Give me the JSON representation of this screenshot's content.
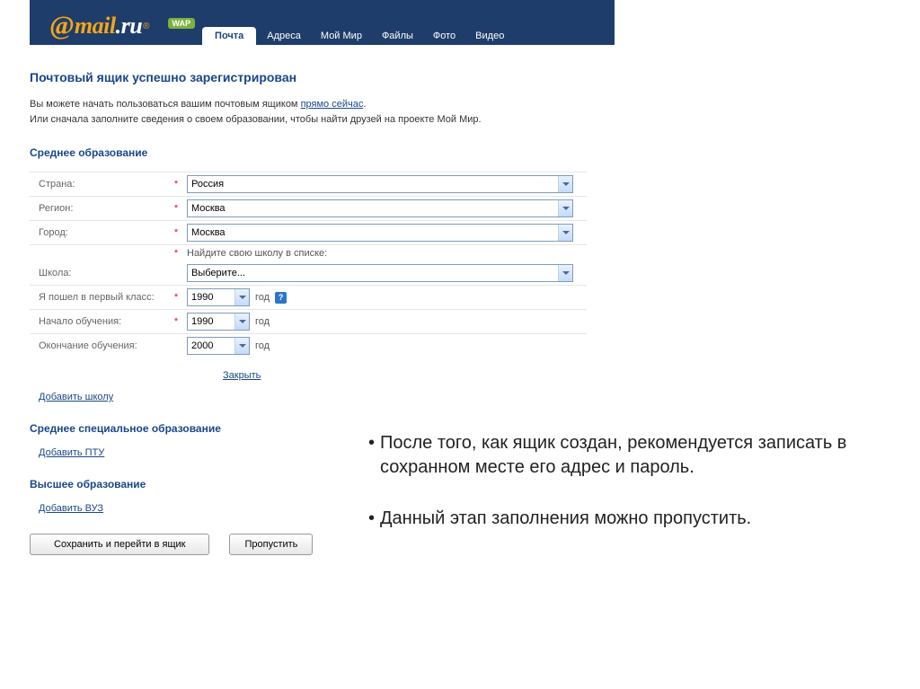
{
  "header": {
    "logo_at": "@",
    "logo_main": "mail",
    "logo_dot": ".",
    "logo_ru": "ru",
    "logo_r": "®",
    "wap": "WAP",
    "tabs": [
      "Почта",
      "Адреса",
      "Мой Мир",
      "Файлы",
      "Фото",
      "Видео"
    ]
  },
  "page": {
    "title": "Почтовый ящик успешно зарегистрирован",
    "intro_line1_a": "Вы можете начать пользоваться вашим почтовым ящиком ",
    "intro_link": "прямо сейчас",
    "intro_line1_b": ".",
    "intro_line2": "Или сначала заполните сведения о своем образовании, чтобы найти друзей на проекте Мой Мир."
  },
  "sections": {
    "secondary": "Среднее образование",
    "vocational": "Среднее специальное образование",
    "higher": "Высшее образование"
  },
  "form": {
    "country_label": "Страна:",
    "country_value": "Россия",
    "region_label": "Регион:",
    "region_value": "Москва",
    "city_label": "Город:",
    "city_value": "Москва",
    "school_note": "Найдите свою школу в списке:",
    "school_label": "Школа:",
    "school_value": "Выберите...",
    "first_grade_label": "Я пошел в первый класс:",
    "first_grade_value": "1990",
    "start_label": "Начало обучения:",
    "start_value": "1990",
    "end_label": "Окончание обучения:",
    "end_value": "2000",
    "year_suffix": "год",
    "help": "?"
  },
  "links": {
    "close": "Закрыть",
    "add_school": "Добавить школу",
    "add_ptu": "Добавить ПТУ",
    "add_vuz": "Добавить ВУЗ"
  },
  "buttons": {
    "save": "Сохранить и перейти в ящик",
    "skip": "Пропустить"
  },
  "annotation": {
    "b1": "После того, как ящик создан, рекомендуется записать в сохранном месте  его адрес и пароль.",
    "b2": "Данный этап заполнения можно пропустить."
  },
  "star": "*"
}
